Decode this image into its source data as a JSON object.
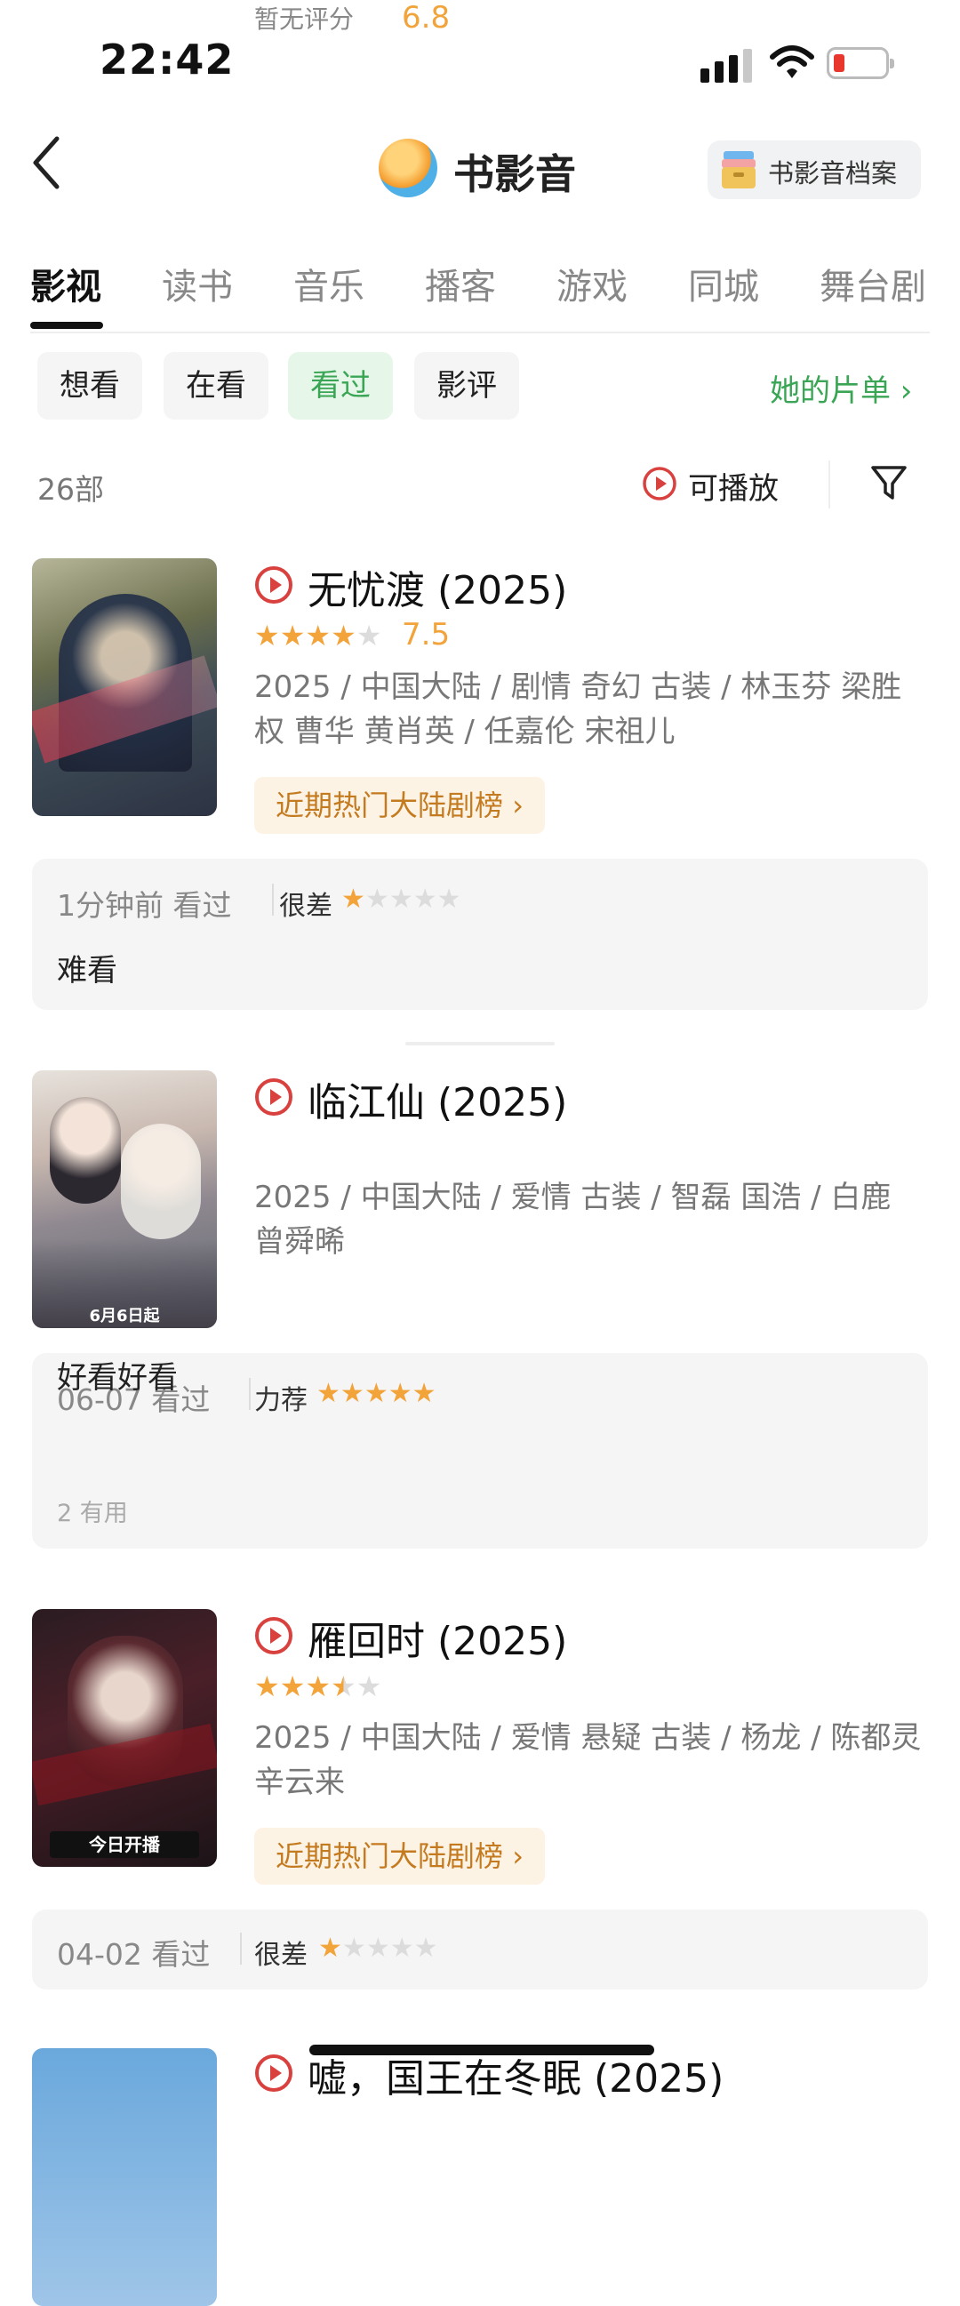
{
  "status_bar": {
    "time": "22:42"
  },
  "header": {
    "title": "书影音",
    "archive_label": "书影音档案"
  },
  "tabs": [
    "影视",
    "读书",
    "音乐",
    "播客",
    "游戏",
    "同城",
    "舞台剧"
  ],
  "chips": [
    "想看",
    "在看",
    "看过",
    "影评"
  ],
  "selected_chip": "看过",
  "her_list": "她的片单",
  "count_label": "26部",
  "playable_label": "可播放",
  "colors": {
    "accent_green": "#3aa655",
    "star": "#f2a33a",
    "play_red": "#d9413f",
    "rank_text": "#c47a1f"
  },
  "items": [
    {
      "title": "无忧渡 (2025)",
      "stars_on": 4,
      "rating": "7.5",
      "meta": "2025 / 中国大陆 / 剧情 奇幻 古装 / 林玉芬 梁胜权 曹华 黄肖英 / 任嘉伦 宋祖儿",
      "rank": "近期热门大陆剧榜",
      "review": {
        "date": "1分钟前 看过",
        "tag": "很差",
        "stars_on": 1,
        "text": "难看"
      }
    },
    {
      "title": "临江仙 (2025)",
      "no_rating": "暂无评分",
      "meta": "2025 / 中国大陆 / 爱情 古装 / 智磊 国浩 / 白鹿 曾舜晞",
      "poster_text": "6月6日起",
      "review": {
        "date": "06-07 看过",
        "tag": "力荐",
        "stars_on": 5,
        "text": "好看好看",
        "useful": "2 有用"
      }
    },
    {
      "title": "雁回时 (2025)",
      "stars_on": 3.5,
      "rating": "6.8",
      "meta": "2025 / 中国大陆 / 爱情 悬疑 古装 / 杨龙 / 陈都灵 辛云来",
      "rank": "近期热门大陆剧榜",
      "poster_text": "今日开播",
      "review": {
        "date": "04-02 看过",
        "tag": "很差",
        "stars_on": 1
      }
    },
    {
      "title": "嘘，国王在冬眠 (2025)"
    }
  ]
}
